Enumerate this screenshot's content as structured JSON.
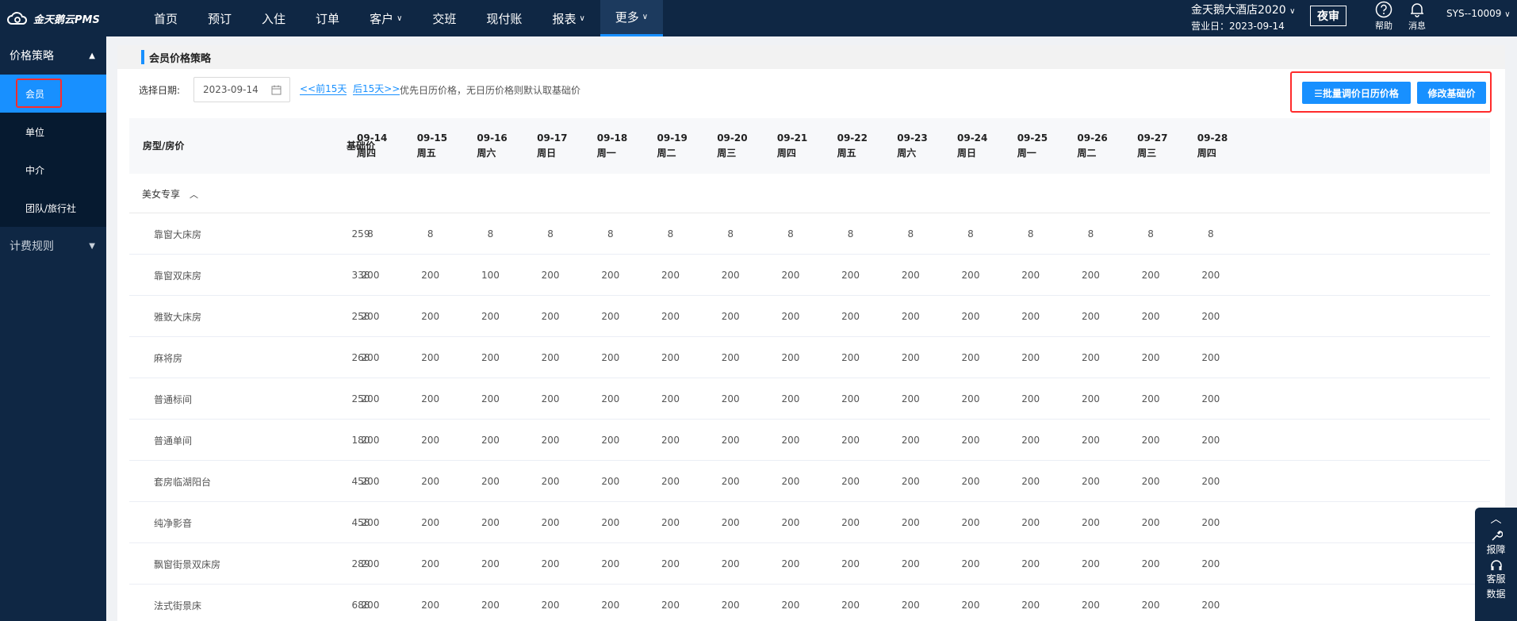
{
  "app": {
    "logo_text": "金天鹅云PMS"
  },
  "nav": [
    {
      "label": "首页",
      "caret": false,
      "active": false
    },
    {
      "label": "预订",
      "caret": false,
      "active": false
    },
    {
      "label": "入住",
      "caret": false,
      "active": false
    },
    {
      "label": "订单",
      "caret": false,
      "active": false
    },
    {
      "label": "客户",
      "caret": true,
      "active": false
    },
    {
      "label": "交班",
      "caret": false,
      "active": false
    },
    {
      "label": "现付账",
      "caret": false,
      "active": false
    },
    {
      "label": "报表",
      "caret": true,
      "active": false
    },
    {
      "label": "更多",
      "caret": true,
      "active": true
    }
  ],
  "header": {
    "hotel_name": "金天鹅大酒店2020",
    "business_date": "营业日：2023-09-14",
    "night_audit": "夜审",
    "help": "帮助",
    "messages": "消息",
    "user": "SYS--10009"
  },
  "sidebar": {
    "group1": "价格策略",
    "items": [
      "会员",
      "单位",
      "中介",
      "团队/旅行社"
    ],
    "group2": "计费规则"
  },
  "panel": {
    "title": "会员价格策略"
  },
  "toolbar": {
    "date_label": "选择日期:",
    "date_value": "2023-09-14",
    "prev": "<<前15天",
    "next": "后15天>>",
    "hint": "优先日历价格，无日历价格则默认取基础价",
    "batch_btn": "☰批量调价日历价格",
    "base_btn": "修改基础价"
  },
  "table": {
    "col_room": "房型/房价",
    "col_base": "基础价",
    "days": [
      {
        "date": "09-14",
        "weekday": "周四"
      },
      {
        "date": "09-15",
        "weekday": "周五"
      },
      {
        "date": "09-16",
        "weekday": "周六"
      },
      {
        "date": "09-17",
        "weekday": "周日"
      },
      {
        "date": "09-18",
        "weekday": "周一"
      },
      {
        "date": "09-19",
        "weekday": "周二"
      },
      {
        "date": "09-20",
        "weekday": "周三"
      },
      {
        "date": "09-21",
        "weekday": "周四"
      },
      {
        "date": "09-22",
        "weekday": "周五"
      },
      {
        "date": "09-23",
        "weekday": "周六"
      },
      {
        "date": "09-24",
        "weekday": "周日"
      },
      {
        "date": "09-25",
        "weekday": "周一"
      },
      {
        "date": "09-26",
        "weekday": "周二"
      },
      {
        "date": "09-27",
        "weekday": "周三"
      },
      {
        "date": "09-28",
        "weekday": "周四"
      }
    ],
    "group": "美女专享",
    "rows": [
      {
        "name": "靠窗大床房",
        "base": "259",
        "prices": [
          "8",
          "8",
          "8",
          "8",
          "8",
          "8",
          "8",
          "8",
          "8",
          "8",
          "8",
          "8",
          "8",
          "8",
          "8"
        ]
      },
      {
        "name": "靠窗双床房",
        "base": "338",
        "prices": [
          "200",
          "200",
          "100",
          "200",
          "200",
          "200",
          "200",
          "200",
          "200",
          "200",
          "200",
          "200",
          "200",
          "200",
          "200"
        ]
      },
      {
        "name": "雅致大床房",
        "base": "258",
        "prices": [
          "200",
          "200",
          "200",
          "200",
          "200",
          "200",
          "200",
          "200",
          "200",
          "200",
          "200",
          "200",
          "200",
          "200",
          "200"
        ]
      },
      {
        "name": "麻将房",
        "base": "268",
        "prices": [
          "200",
          "200",
          "200",
          "200",
          "200",
          "200",
          "200",
          "200",
          "200",
          "200",
          "200",
          "200",
          "200",
          "200",
          "200"
        ]
      },
      {
        "name": "普通标间",
        "base": "250",
        "prices": [
          "200",
          "200",
          "200",
          "200",
          "200",
          "200",
          "200",
          "200",
          "200",
          "200",
          "200",
          "200",
          "200",
          "200",
          "200"
        ]
      },
      {
        "name": "普通单间",
        "base": "180",
        "prices": [
          "200",
          "200",
          "200",
          "200",
          "200",
          "200",
          "200",
          "200",
          "200",
          "200",
          "200",
          "200",
          "200",
          "200",
          "200"
        ]
      },
      {
        "name": "套房临湖阳台",
        "base": "458",
        "prices": [
          "200",
          "200",
          "200",
          "200",
          "200",
          "200",
          "200",
          "200",
          "200",
          "200",
          "200",
          "200",
          "200",
          "200",
          "200"
        ]
      },
      {
        "name": "纯净影音",
        "base": "458",
        "prices": [
          "200",
          "200",
          "200",
          "200",
          "200",
          "200",
          "200",
          "200",
          "200",
          "200",
          "200",
          "200",
          "200",
          "200",
          "200"
        ]
      },
      {
        "name": "飘窗街景双床房",
        "base": "289",
        "prices": [
          "200",
          "200",
          "200",
          "200",
          "200",
          "200",
          "200",
          "200",
          "200",
          "200",
          "200",
          "200",
          "200",
          "200",
          "200"
        ]
      },
      {
        "name": "法式街景床",
        "base": "688",
        "prices": [
          "200",
          "200",
          "200",
          "200",
          "200",
          "200",
          "200",
          "200",
          "200",
          "200",
          "200",
          "200",
          "200",
          "200",
          "200"
        ]
      }
    ]
  },
  "float": {
    "report": "报障",
    "service": "客服",
    "data": "数据"
  }
}
